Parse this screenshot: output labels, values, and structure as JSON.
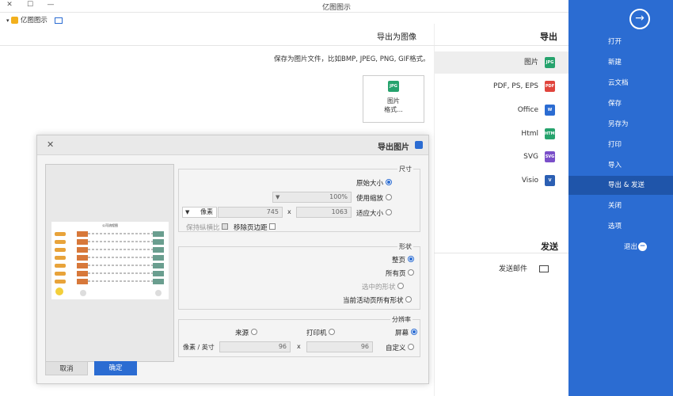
{
  "window": {
    "title": "亿图图示",
    "minimize": "—",
    "maximize": "☐",
    "close": "✕"
  },
  "quick_access": {
    "label": "亿图图示"
  },
  "sidebar": {
    "back_icon": "arrow-right-circle-icon",
    "items": [
      {
        "label": "打开"
      },
      {
        "label": "新建"
      },
      {
        "label": "云文档"
      },
      {
        "label": "保存"
      },
      {
        "label": "另存为"
      },
      {
        "label": "打印"
      },
      {
        "label": "导入"
      },
      {
        "label": "导出 & 发送"
      },
      {
        "label": "关闭"
      },
      {
        "label": "选项"
      },
      {
        "label": "退出"
      }
    ]
  },
  "export": {
    "heading": "导出",
    "items": [
      {
        "label": "图片",
        "icon": "JPG",
        "color": "#26a36d"
      },
      {
        "label": "PDF, PS, EPS",
        "icon": "PDF",
        "color": "#e0443c"
      },
      {
        "label": "Office",
        "icon": "W",
        "color": "#2b6cd2"
      },
      {
        "label": "Html",
        "icon": "HTML",
        "color": "#26a36d"
      },
      {
        "label": "SVG",
        "icon": "SVG",
        "color": "#7a4fc9"
      },
      {
        "label": "Visio",
        "icon": "V",
        "color": "#2b5fb3"
      }
    ],
    "send_heading": "发送",
    "send_item": "发送邮件"
  },
  "panel": {
    "title": "导出为图像",
    "description": "保存为图片文件，比如BMP, JPEG, PNG, GIF格式。",
    "card_icon": "JPG",
    "card_label_1": "图片",
    "card_label_2": "格式..."
  },
  "dialog": {
    "title": "导出图片",
    "close": "✕",
    "size": {
      "label": "尺寸",
      "original": "原始大小",
      "scale": "使用缩放",
      "scale_value": "100%",
      "fit": "适应大小",
      "width": "1063",
      "x": "x",
      "height": "745",
      "unit": "像素",
      "remove_margin": "移除页边距",
      "keep_ratio": "保持纵横比"
    },
    "shape": {
      "label": "形状",
      "whole_page": "整页",
      "all_pages": "所有页",
      "selected": "选中的形状",
      "current_all": "当前活动页所有形状"
    },
    "resolution": {
      "label": "分辨率",
      "screen": "屏幕",
      "printer": "打印机",
      "source": "来源",
      "custom": "自定义",
      "dpi_x": "96",
      "x": "x",
      "dpi_y": "96",
      "unit": "像素 / 英寸"
    },
    "ok": "确定",
    "cancel": "取消",
    "preview_title": "公司流程图"
  },
  "colors": {
    "accent": "#2b6cd2",
    "accent_dark": "#1f55aa"
  }
}
